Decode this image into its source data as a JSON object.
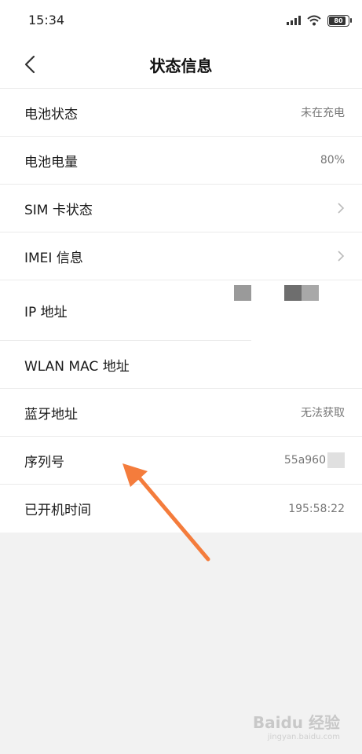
{
  "status_bar": {
    "time": "15:34",
    "battery_level": "80"
  },
  "header": {
    "title": "状态信息"
  },
  "rows": [
    {
      "label": "电池状态",
      "value": "未在充电"
    },
    {
      "label": "电池电量",
      "value": "80%"
    },
    {
      "label": "SIM 卡状态",
      "value": ""
    },
    {
      "label": "IMEI 信息",
      "value": ""
    },
    {
      "label": "IP 地址",
      "value": ""
    },
    {
      "label": "WLAN MAC 地址",
      "value": ""
    },
    {
      "label": "蓝牙地址",
      "value": "无法获取"
    },
    {
      "label": "序列号",
      "value": "55a960"
    },
    {
      "label": "已开机时间",
      "value": "195:58:22"
    }
  ],
  "watermark": {
    "text": "Baidu 经验",
    "sub": "jingyan.baidu.com"
  },
  "colors": {
    "arrow": "#f47c3c",
    "background": "#f2f2f2"
  }
}
